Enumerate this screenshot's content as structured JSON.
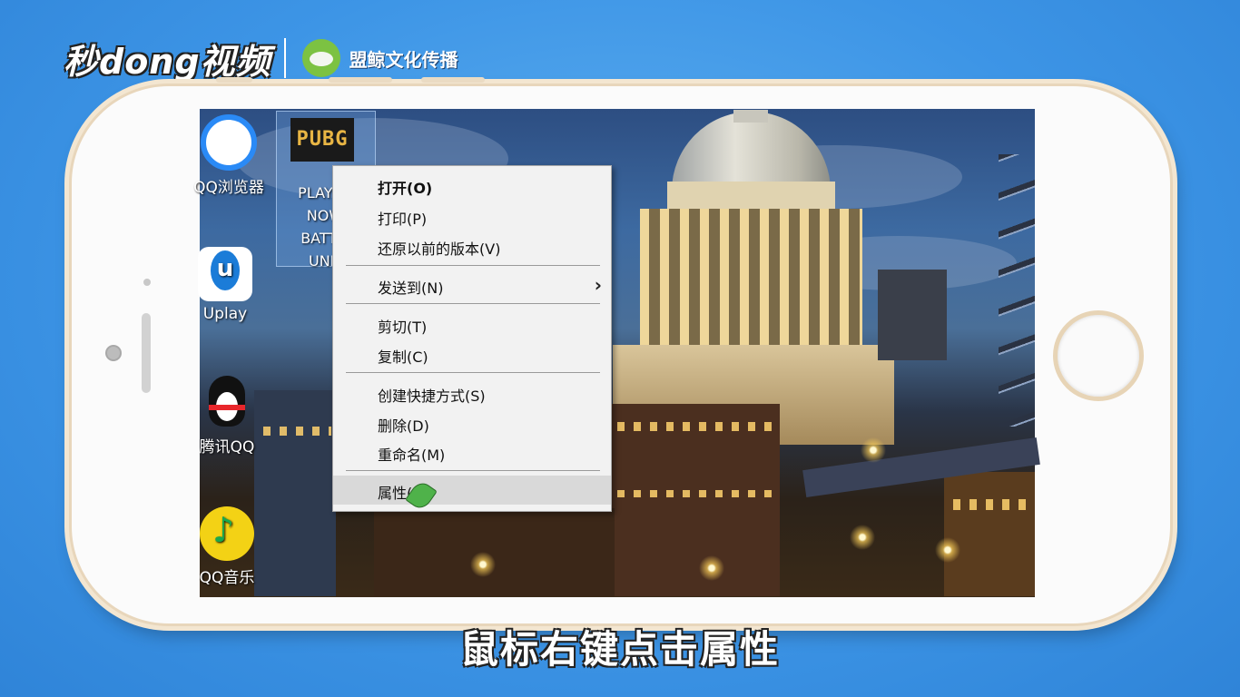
{
  "brand": {
    "main": "秒dong视频",
    "sub": "盟鲸文化传播"
  },
  "desktop": {
    "icons": [
      {
        "label": "QQ浏览器"
      },
      {
        "label": "Uplay"
      },
      {
        "label": "腾讯QQ"
      },
      {
        "label": "QQ音乐"
      }
    ],
    "selected_icon": {
      "logo": "PUBG",
      "label_lines": [
        "PLAYER",
        "NOW",
        "BATTLI",
        "UND"
      ]
    }
  },
  "context_menu": {
    "items": [
      {
        "label": "打开(O)",
        "bold": true
      },
      {
        "label": "打印(P)"
      },
      {
        "label": "还原以前的版本(V)"
      },
      {
        "label": "发送到(N)",
        "submenu": true
      },
      {
        "label": "剪切(T)"
      },
      {
        "label": "复制(C)"
      },
      {
        "label": "创建快捷方式(S)"
      },
      {
        "label": "删除(D)"
      },
      {
        "label": "重命名(M)"
      },
      {
        "label": "属性(R)",
        "highlighted": true
      }
    ],
    "chevron": "›"
  },
  "caption": "鼠标右键点击属性",
  "colors": {
    "background": "#3d95e6",
    "phone_frame": "#e8d6bb",
    "menu_bg": "#f2f2f2",
    "menu_highlight": "#d9d9d9"
  }
}
